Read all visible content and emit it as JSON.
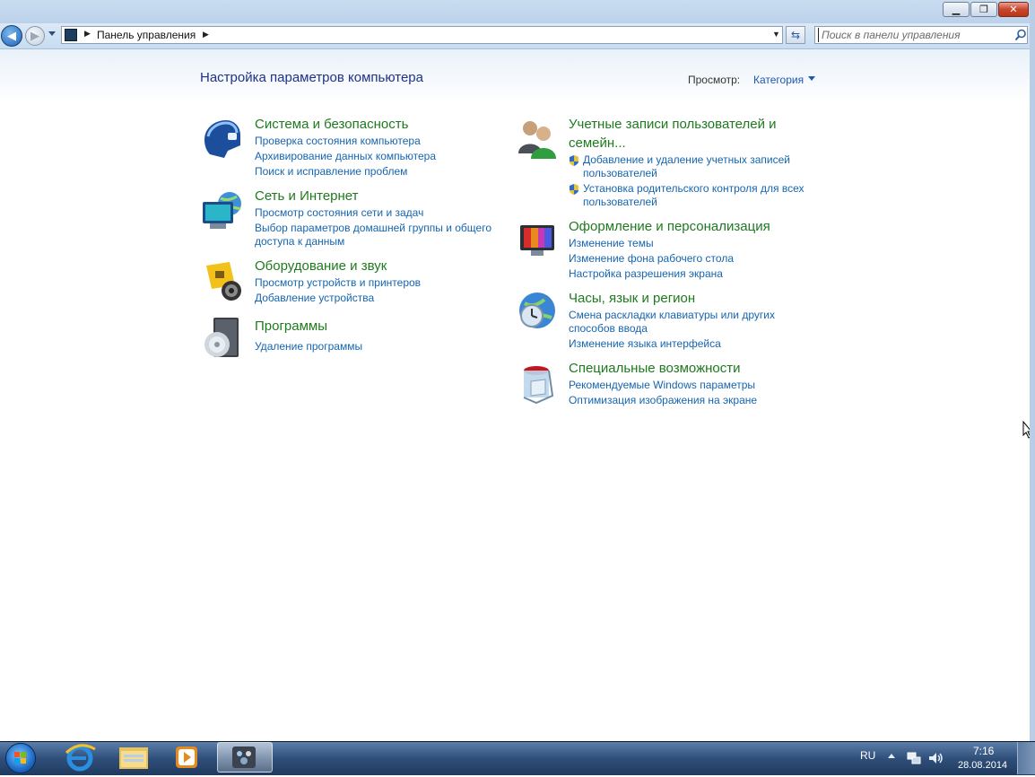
{
  "window": {
    "minimize_glyph": "▁",
    "maximize_glyph": "❐",
    "close_glyph": "✕"
  },
  "navigation": {
    "back_glyph": "◀",
    "forward_glyph": "▶",
    "address_path": "Панель управления",
    "search_placeholder": "Поиск в панели управления"
  },
  "header": {
    "title": "Настройка параметров компьютера",
    "view_label": "Просмотр:",
    "view_value": "Категория"
  },
  "categories_left": [
    {
      "title": "Система и безопасность",
      "icon": "security-shield-icon",
      "tasks": [
        "Проверка состояния компьютера",
        "Архивирование данных компьютера",
        "Поиск и исправление проблем"
      ]
    },
    {
      "title": "Сеть и Интернет",
      "icon": "network-globe-icon",
      "tasks": [
        "Просмотр состояния сети и задач",
        "Выбор параметров домашней группы и общего доступа к данным"
      ]
    },
    {
      "title": "Оборудование и звук",
      "icon": "hardware-sound-icon",
      "tasks": [
        "Просмотр устройств и принтеров",
        "Добавление устройства"
      ]
    },
    {
      "title": "Программы",
      "icon": "programs-disc-icon",
      "tasks": [
        "Удаление программы"
      ]
    }
  ],
  "categories_right": [
    {
      "title": "Учетные записи пользователей и семейн...",
      "icon": "user-accounts-icon",
      "tasks": [
        "Добавление и удаление учетных записей пользователей",
        "Установка родительского контроля для всех пользователей"
      ]
    },
    {
      "title": "Оформление и персонализация",
      "icon": "personalization-monitor-icon",
      "tasks": [
        "Изменение темы",
        "Изменение фона рабочего стола",
        "Настройка разрешения экрана"
      ]
    },
    {
      "title": "Часы, язык и регион",
      "icon": "clock-globe-icon",
      "tasks": [
        "Смена раскладки клавиатуры или других способов ввода",
        "Изменение языка интерфейса"
      ]
    },
    {
      "title": "Специальные возможности",
      "icon": "accessibility-icon",
      "tasks": [
        "Рекомендуемые Windows параметры",
        "Оптимизация изображения на экране"
      ]
    }
  ],
  "taskbar": {
    "apps": [
      "start-orb-icon",
      "internet-explorer-icon",
      "explorer-folder-icon",
      "media-player-icon",
      "control-panel-icon"
    ],
    "language": "RU",
    "time": "7:16",
    "date": "28.08.2014"
  },
  "colors": {
    "category_title": "#1e7a1e",
    "task_link": "#1565b0",
    "page_title": "#1e3287"
  }
}
